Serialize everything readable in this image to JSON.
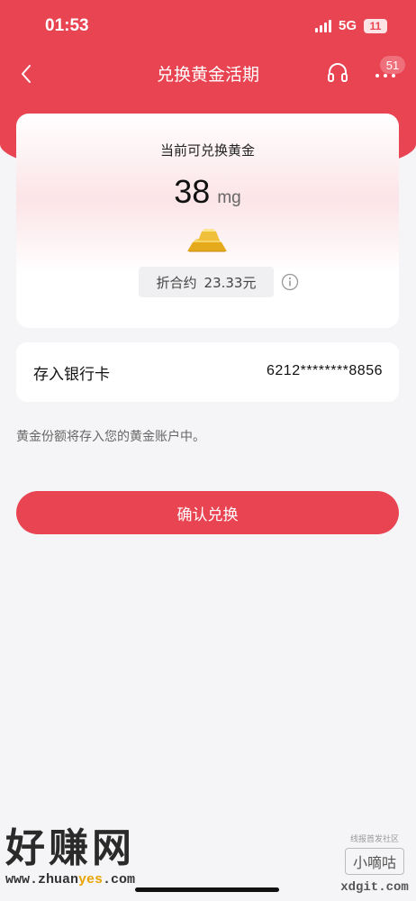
{
  "status_bar": {
    "time": "01:53",
    "network": "5G",
    "battery": "11"
  },
  "nav": {
    "title": "兑换黄金活期",
    "more_badge": "51"
  },
  "gold_card": {
    "label": "当前可兑换黄金",
    "amount": "38",
    "unit": "mg",
    "equivalent_label": "折合约",
    "equivalent_value": "23.33元"
  },
  "bank": {
    "label": "存入银行卡",
    "card_number": "6212********8856"
  },
  "note": "黄金份额将存入您的黄金账户中。",
  "confirm_button": "确认兑换",
  "watermark": {
    "left_big": "好赚网",
    "left_url_prefix": "www.zhuan",
    "left_url_yes": "yes",
    "left_url_suffix": ".com",
    "right_small": "线报首发社区",
    "right_box": "小嘀咕",
    "right_url": "xdgit.com"
  },
  "colors": {
    "accent": "#e84452",
    "background": "#f5f5f7"
  }
}
